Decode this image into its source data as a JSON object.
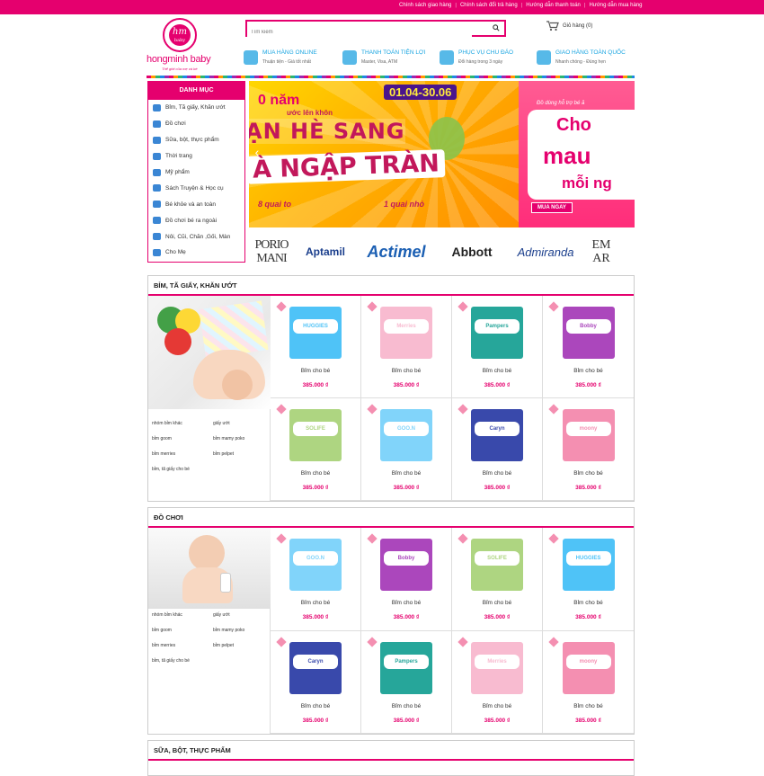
{
  "topbar": {
    "links": [
      "Chính sách giao hàng",
      "Chính sách đổi trả hàng",
      "Hướng dẫn thanh toán",
      "Hướng dẫn mua hàng"
    ],
    "color": "#e5006e"
  },
  "logo": {
    "mark": "hm",
    "mark_sub": "baby",
    "name": "hongminh baby",
    "tagline": "Thế giới của mẹ và bé"
  },
  "search": {
    "placeholder": "Tìm kiếm"
  },
  "cart": {
    "label": "Giỏ hàng (0)"
  },
  "features": [
    {
      "title": "MUA HÀNG ONLINE",
      "sub": "Thuận tiện - Giá tốt nhất"
    },
    {
      "title": "THANH TOÁN TIỆN LỢI",
      "sub": "Master, Visa, ATM"
    },
    {
      "title": "PHỤC VỤ CHU ĐÁO",
      "sub": "Đổi hàng trong 3 ngày"
    },
    {
      "title": "GIAO HÀNG TOÀN QUỐC",
      "sub": "Nhanh chóng - Đúng hẹn"
    }
  ],
  "sidebar": {
    "title": "DANH MỤC",
    "items": [
      "Bỉm, Tã giấy, Khăn ướt",
      "Đồ chơi",
      "Sữa, bột, thực phẩm",
      "Thời trang",
      "Mỹ phẩm",
      "Sách Truyện & Học cụ",
      "Bé khỏe và an toàn",
      "Đồ chơi bé ra ngoài",
      "Nôi, Cũi, Chăn ,Gối, Màn",
      "Cho Mẹ"
    ]
  },
  "banner": {
    "date": "01.04-30.06",
    "line1": "0 năm",
    "line1b": "ước lên khôn",
    "line2": "ẠN HÈ SANG",
    "line3": "À NGẬP TRÀN",
    "line4": "8 quai to",
    "line5": "1 quai nhỏ",
    "side_top": "Đồ dùng hỗ trợ bé ă",
    "side_1": "Cho",
    "side_2": "mau",
    "side_3": "mỗi ng",
    "side_btn": "MUA NGAY"
  },
  "brands": [
    "PORIO MANI",
    "Aptamil",
    "Actimel",
    "Abbott",
    "Admiranda",
    "EM AR"
  ],
  "sections": [
    {
      "title": "BỈM, TÃ GIẤY, KHĂN ƯỚT",
      "subs": [
        "nhóm bỉm khác",
        "giấy ướt",
        "bỉm goom",
        "bỉm mamy poko",
        "bỉm merries",
        "bỉm pelpet",
        "bỉm, tã giấy cho bé"
      ],
      "products": [
        {
          "name": "Bỉm cho bé",
          "price": "385.000 ₫",
          "brand": "HUGGIES",
          "color": "#4fc3f7"
        },
        {
          "name": "Bỉm cho bé",
          "price": "385.000 ₫",
          "brand": "Merries",
          "color": "#f8bbd0"
        },
        {
          "name": "Bỉm cho bé",
          "price": "385.000 ₫",
          "brand": "Pampers",
          "color": "#26a69a"
        },
        {
          "name": "Bỉm cho bé",
          "price": "385.000 ₫",
          "brand": "Bobby",
          "color": "#ab47bc"
        },
        {
          "name": "Bỉm cho bé",
          "price": "385.000 ₫",
          "brand": "SOLIFE",
          "color": "#aed581"
        },
        {
          "name": "Bỉm cho bé",
          "price": "385.000 ₫",
          "brand": "GOO.N",
          "color": "#81d4fa"
        },
        {
          "name": "Bỉm cho bé",
          "price": "385.000 ₫",
          "brand": "Caryn",
          "color": "#3949ab"
        },
        {
          "name": "Bỉm cho bé",
          "price": "385.000 ₫",
          "brand": "moony",
          "color": "#f48fb1"
        }
      ]
    },
    {
      "title": "ĐỒ CHƠI",
      "subs": [
        "nhóm bỉm khác",
        "giấy ướt",
        "bỉm goom",
        "bỉm mamy poko",
        "bỉm merries",
        "bỉm pelpet",
        "bỉm, tã giấy cho bé"
      ],
      "products": [
        {
          "name": "Bỉm cho bé",
          "price": "385.000 ₫",
          "brand": "GOO.N",
          "color": "#81d4fa"
        },
        {
          "name": "Bỉm cho bé",
          "price": "385.000 ₫",
          "brand": "Bobby",
          "color": "#ab47bc"
        },
        {
          "name": "Bỉm cho bé",
          "price": "385.000 ₫",
          "brand": "SOLIFE",
          "color": "#aed581"
        },
        {
          "name": "Bỉm cho bé",
          "price": "385.000 ₫",
          "brand": "HUGGIES",
          "color": "#4fc3f7"
        },
        {
          "name": "Bỉm cho bé",
          "price": "385.000 ₫",
          "brand": "Caryn",
          "color": "#3949ab"
        },
        {
          "name": "Bỉm cho bé",
          "price": "385.000 ₫",
          "brand": "Pampers",
          "color": "#26a69a"
        },
        {
          "name": "Bỉm cho bé",
          "price": "385.000 ₫",
          "brand": "Merries",
          "color": "#f8bbd0"
        },
        {
          "name": "Bỉm cho bé",
          "price": "385.000 ₫",
          "brand": "moony",
          "color": "#f48fb1"
        }
      ]
    },
    {
      "title": "SỮA, BỘT, THỰC PHẨM",
      "subs": [],
      "products": []
    }
  ]
}
